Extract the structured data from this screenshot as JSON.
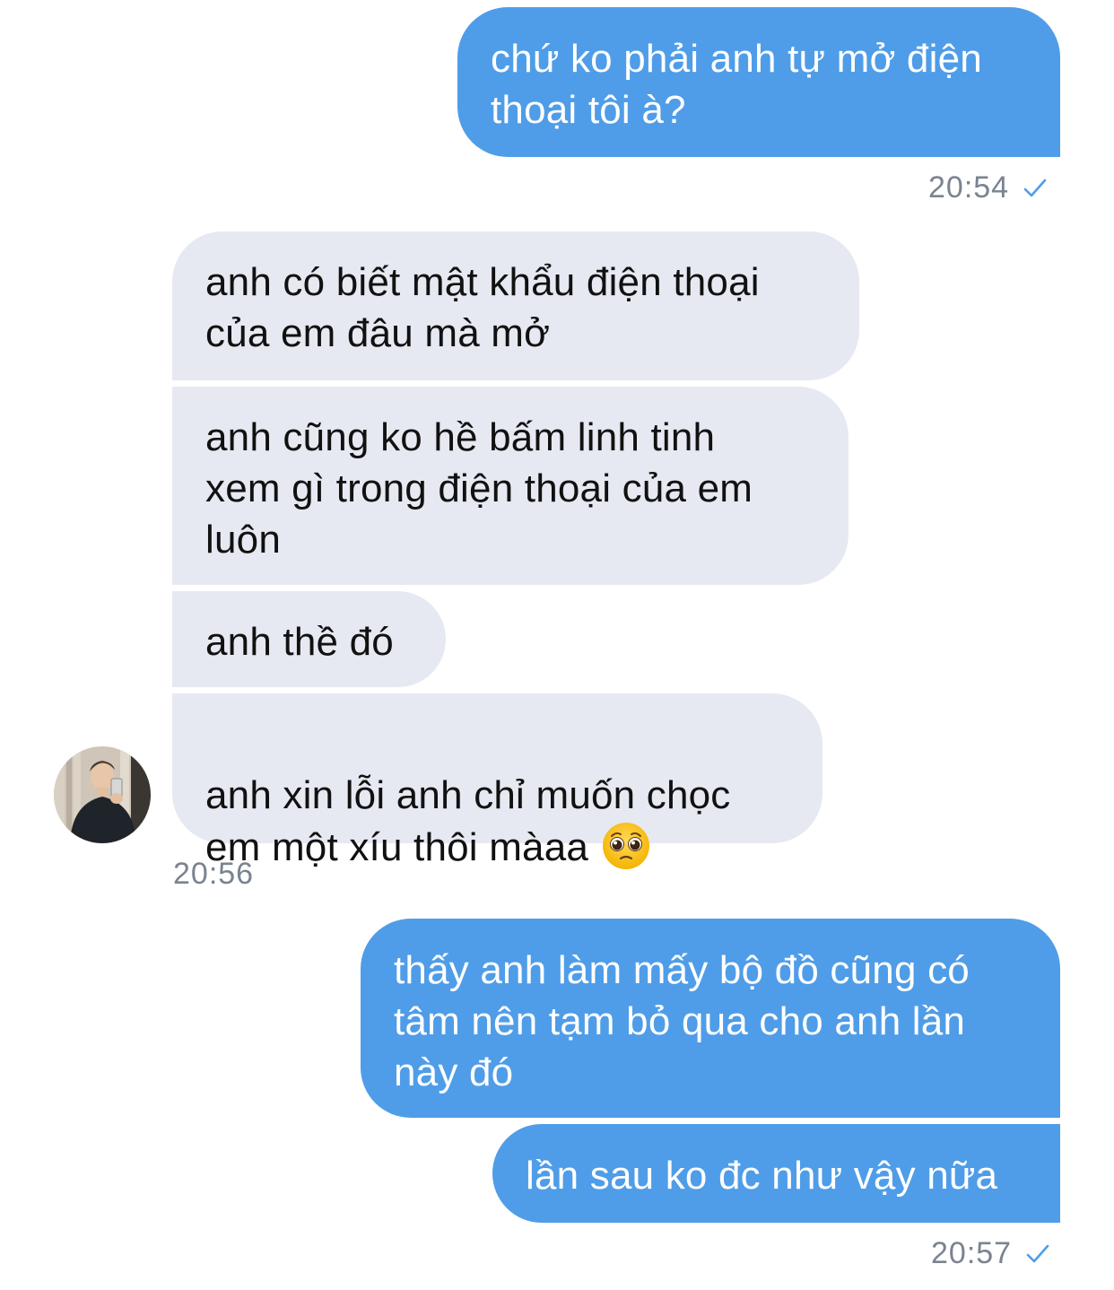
{
  "messages": [
    {
      "text": "chứ ko phải anh tự mở điện\nthoại tôi à?"
    },
    {
      "text": "anh có biết mật khẩu điện thoại\ncủa em đâu mà mở"
    },
    {
      "text": "anh cũng ko hề bấm linh tinh\nxem gì trong điện thoại của em\nluôn"
    },
    {
      "text": "anh thề đó"
    },
    {
      "text": "anh xin lỗi anh chỉ muốn chọc\nem một xíu thôi màaa",
      "emoji": "pleading-face"
    },
    {
      "text": "thấy anh làm mấy bộ đồ cũng có\ntâm nên tạm bỏ qua cho anh lần\nnày đó"
    },
    {
      "text": "lần sau ko đc như vậy nữa"
    }
  ],
  "timestamps": [
    "20:54",
    "20:56",
    "20:57"
  ],
  "colors": {
    "outgoing_bubble": "#4f9de8",
    "incoming_bubble": "#e6e9f1",
    "timestamp": "#7a8390",
    "read_check": "#4f9de8"
  },
  "icons": [
    "check-icon",
    "avatar",
    "pleading-face-emoji"
  ]
}
